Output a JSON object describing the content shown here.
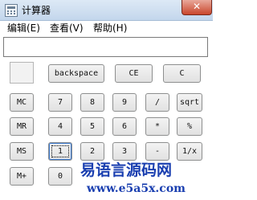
{
  "window": {
    "title": "计算器",
    "close_symbol": "✕"
  },
  "menu": {
    "edit": "编辑(E)",
    "view": "查看(V)",
    "help": "帮助(H)"
  },
  "display": {
    "value": ""
  },
  "buttons": {
    "backspace": "backspace",
    "ce": "CE",
    "c": "C",
    "mc": "MC",
    "mr": "MR",
    "ms": "MS",
    "mplus": "M+",
    "n7": "7",
    "n8": "8",
    "n9": "9",
    "divide": "/",
    "sqrt": "sqrt",
    "n4": "4",
    "n5": "5",
    "n6": "6",
    "multiply": "*",
    "percent": "%",
    "n1": "1",
    "n2": "2",
    "n3": "3",
    "minus": "-",
    "reciprocal": "1/x",
    "n0": "0"
  },
  "watermark": {
    "line1": "易语言源码网",
    "line2": "www.e5a5x.com"
  },
  "colors": {
    "titlebar": "#c3d6ec",
    "close": "#c9462c",
    "watermark": "#1a3fb0"
  },
  "icons": {
    "app": "calculator-icon",
    "close": "close-icon"
  }
}
